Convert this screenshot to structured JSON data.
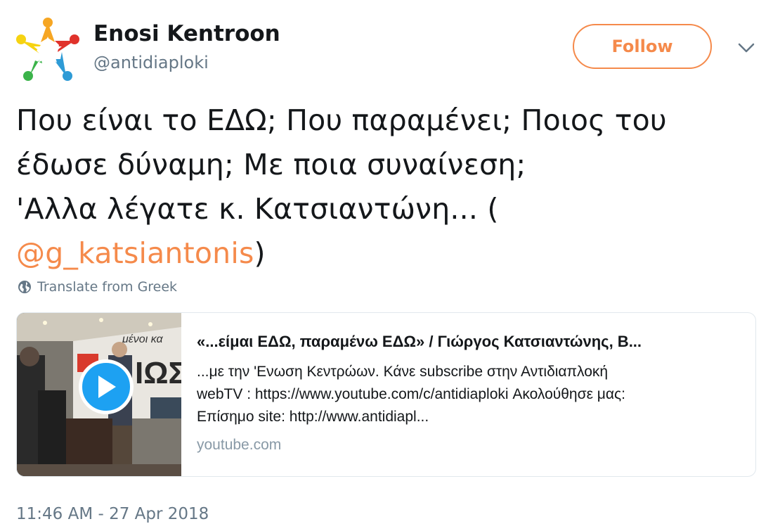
{
  "header": {
    "display_name": "Enosi Kentroon",
    "handle": "@antidiaploki",
    "follow_label": "Follow"
  },
  "tweet": {
    "line1": "Που είναι το ΕΔΩ; Που παραμένει; Ποιος του",
    "line2": "έδωσε δύναμη; Με ποια συναίνεση;",
    "line3": "'Αλλα λέγατε κ. Κατσιαντώνη... (",
    "mention": "@g_katsiantonis",
    "mention_suffix": ")"
  },
  "translate_label": "Translate from Greek",
  "card": {
    "title": "«...είμαι ΕΔΩ, παραμένω ΕΔΩ» / Γιώργος Κατσιαντώνης, Β...",
    "desc_line1": "...με την 'Ενωση Κεντρώων. Κάνε subscribe στην Αντιδιαπλοκή",
    "desc_line2": "webTV : https://www.youtube.com/c/antidiaploki Ακολούθησε μας:",
    "desc_line3": "Επίσημο site: http://www.antidiapl...",
    "domain": "youtube.com",
    "thumb_banner_text": "μένοι κα",
    "thumb_big_text": "ΙΩΣ"
  },
  "timestamp": "11:46 AM - 27 Apr 2018",
  "icons": {
    "avatar": "star-logo-avatar",
    "caret": "chevron-down-icon",
    "translate": "globe-icon",
    "play": "play-icon"
  },
  "colors": {
    "accent": "#f58a4b",
    "text": "#14171a",
    "secondary": "#657786",
    "play": "#1da1f2"
  }
}
